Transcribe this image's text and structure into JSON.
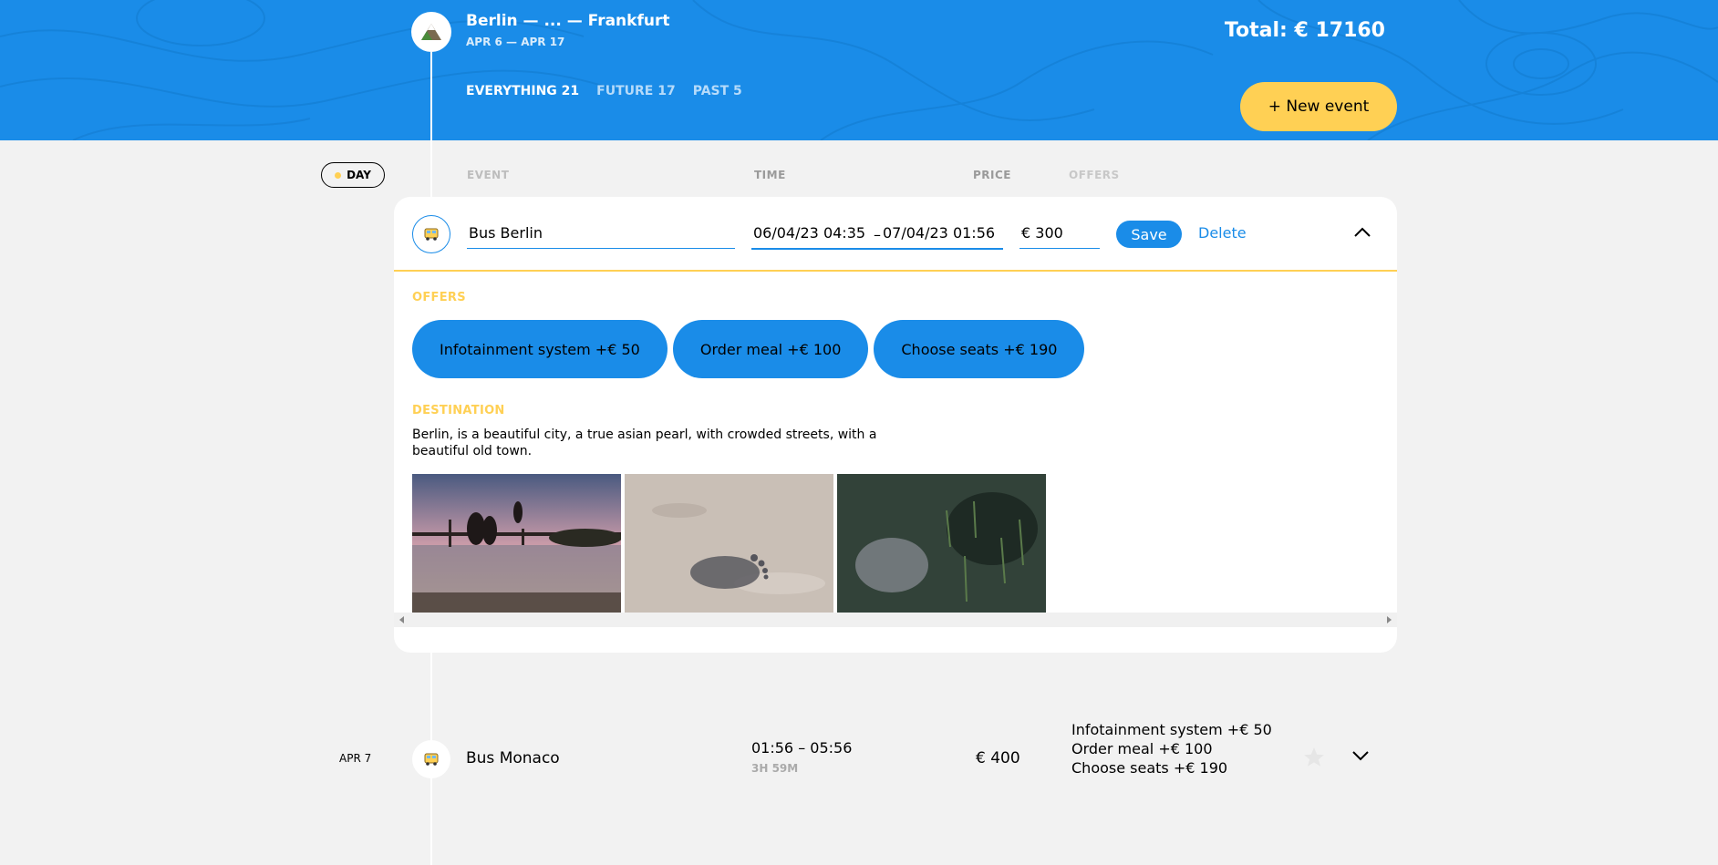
{
  "header": {
    "trip_title": "Berlin — ... — Frankfurt",
    "trip_dates": "APR 6 — APR 17",
    "total": "Total: € 17160",
    "new_event_label": "+ New event",
    "filters": [
      {
        "label": "EVERYTHING 21",
        "active": true
      },
      {
        "label": "FUTURE 17",
        "active": false
      },
      {
        "label": "PAST 5",
        "active": false
      }
    ]
  },
  "sort": {
    "day_label": "DAY",
    "event_label": "EVENT",
    "time_label": "TIME",
    "price_label": "PRICE",
    "offers_label": "OFFERS"
  },
  "edit_form": {
    "type_icon": "bus-icon",
    "destination_value": "Bus Berlin",
    "start_time": "06/04/23 04:35",
    "time_separator": "–",
    "end_time": "07/04/23 01:56",
    "price_value": "€ 300",
    "save_label": "Save",
    "delete_label": "Delete",
    "offers_title": "OFFERS",
    "offers": [
      {
        "label": "Infotainment system +€  50"
      },
      {
        "label": "Order meal +€  100"
      },
      {
        "label": "Choose seats +€  190"
      }
    ],
    "destination_title": "DESTINATION",
    "destination_description": "Berlin, is a beautiful city, a true asian pearl, with crowded streets, with a beautiful old town."
  },
  "events": [
    {
      "date": "APR 7",
      "icon": "bus-icon",
      "name": "Bus Monaco",
      "time_range": "01:56 – 05:56",
      "duration": "3H 59M",
      "price": "€ 400",
      "offers": [
        "Infotainment system +€  50",
        "Order meal +€  100",
        "Choose seats +€  190"
      ]
    }
  ],
  "colors": {
    "accent_blue": "#1a8ce8",
    "accent_yellow": "#ffd054",
    "background": "#f2f2f2"
  }
}
